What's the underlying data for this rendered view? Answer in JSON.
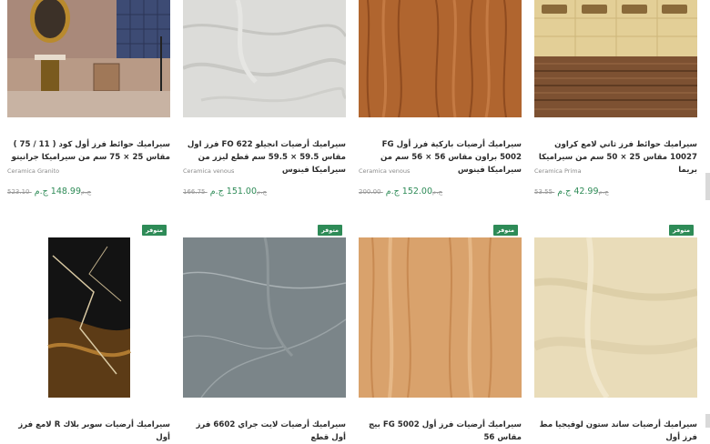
{
  "products": [
    {
      "title": "سيراميك حوائط فرز أول كود ( 11 / 75 ) مقاس 25 × 75 سم من سيراميكا جرانيتو",
      "brand": "Ceramica Granito",
      "old_price": "523.10 ج.م",
      "new_price": "148.99 ج.م"
    },
    {
      "title": "سيراميك أرضيات انجيلو FO 622 فرز اول مقاس 59.5 × 59.5 سم قطع ليزر من سيراميكا فينوس",
      "brand": "Ceramica venous",
      "old_price": "166.75 ج.م",
      "new_price": "151.00 ج.م"
    },
    {
      "title": "سيراميك أرضيات باركية فرز أول FG 5002 براون مقاس 56 × 56 سم من سيراميكا فينوس",
      "brand": "Ceramica venous",
      "old_price": "200.00 ج.م",
      "new_price": "152.00 ج.م"
    },
    {
      "title": "سيراميك حوائط فرز ثاني لامع كراون 10027 مقاس 25 × 50 سم من سيراميكا بريما",
      "brand": "Ceramica Prima",
      "old_price": "53.55 ج.م",
      "new_price": "42.99 ج.م"
    }
  ],
  "bottom_products": [
    {
      "badge": "متوفر",
      "title": "سيراميك أرضيات سوبر بلاك R لامع فرز أول"
    },
    {
      "badge": "متوفر",
      "title": "سيراميك أرضيات لايت جراي 6602 فرز أول قطع"
    },
    {
      "badge": "متوفر",
      "title": "سيراميك أرضيات فرز أول FG 5002 بيج مقاس 56"
    },
    {
      "badge": "متوفر",
      "title": "سيراميك أرضيات ساند ستون لوفيجيا مط فرز أول"
    }
  ]
}
